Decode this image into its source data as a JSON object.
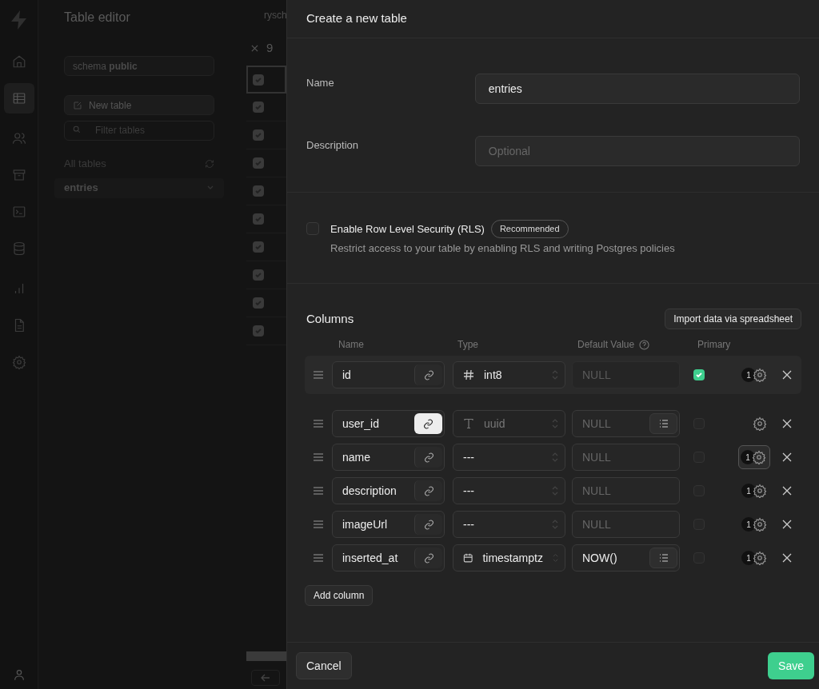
{
  "app": {
    "title": "Table editor",
    "schema": "schema **public**",
    "new_table": "New table",
    "filter": {
      "placeholder": "Filter tables"
    },
    "section": "All tables",
    "tables": [
      {
        "label": "entries",
        "selected": true
      }
    ],
    "grid": {
      "header_fragment": "rysch",
      "count": "9",
      "rows": [
        {
          "checked": true
        },
        {
          "checked": true
        },
        {
          "checked": true
        },
        {
          "checked": true
        },
        {
          "checked": true
        },
        {
          "checked": true
        },
        {
          "checked": true
        },
        {
          "checked": true
        },
        {
          "checked": true
        },
        {
          "checked": true
        }
      ]
    },
    "nav": [
      {
        "kind": "home",
        "selected": false
      },
      {
        "kind": "table",
        "selected": true
      },
      {
        "kind": "users",
        "selected": false
      },
      {
        "kind": "archive",
        "selected": false
      },
      {
        "kind": "terminal",
        "selected": false
      },
      {
        "kind": "database",
        "selected": false
      },
      {
        "kind": "chart",
        "selected": false
      },
      {
        "kind": "document",
        "selected": false
      },
      {
        "kind": "settings",
        "selected": false
      }
    ]
  },
  "panel": {
    "title": "Create a new table",
    "name": {
      "label": "Name",
      "value": "entries"
    },
    "description": {
      "label": "Description",
      "placeholder": "Optional"
    },
    "rls": {
      "checked": false,
      "label": "Enable Row Level Security (RLS)",
      "badge": "Recommended",
      "hint": "Restrict access to your table by enabling RLS and writing Postgres policies"
    },
    "columns": {
      "title": "Columns",
      "import_button": "Import data via spreadsheet",
      "headers": [
        "Name",
        "Type",
        "Default Value",
        "Primary"
      ],
      "rows": [
        {
          "name": "id",
          "link_active": false,
          "kind": "hash",
          "type": "int8",
          "type_disabled": false,
          "default_placeholder": "NULL",
          "default_disabled": true,
          "suggestions": false,
          "primary": true,
          "badge": "1",
          "highlighted": true,
          "focused": false
        },
        {
          "name": "user_id",
          "link_active": true,
          "kind": "text",
          "type": "uuid",
          "type_disabled": true,
          "default_placeholder": "NULL",
          "default_disabled": false,
          "suggestions": true,
          "primary": false,
          "highlighted": false,
          "focused": false
        },
        {
          "name": "name",
          "link_active": false,
          "kind": "none",
          "type": "---",
          "type_disabled": false,
          "default_placeholder": "NULL",
          "default_disabled": false,
          "suggestions": false,
          "primary": false,
          "badge": "1",
          "highlighted": false,
          "focused": true
        },
        {
          "name": "description",
          "link_active": false,
          "kind": "none",
          "type": "---",
          "type_disabled": false,
          "default_placeholder": "NULL",
          "default_disabled": false,
          "suggestions": false,
          "primary": false,
          "badge": "1",
          "highlighted": false,
          "focused": false
        },
        {
          "name": "imageUrl",
          "link_active": false,
          "kind": "none",
          "type": "---",
          "type_disabled": false,
          "default_placeholder": "NULL",
          "default_disabled": false,
          "suggestions": false,
          "primary": false,
          "badge": "1",
          "highlighted": false,
          "focused": false
        },
        {
          "name": "inserted_at",
          "link_active": false,
          "kind": "calendar",
          "type": "timestamptz",
          "type_disabled": false,
          "default_value": "NOW()",
          "default_disabled": false,
          "suggestions": true,
          "primary": false,
          "badge": "1",
          "highlighted": false,
          "focused": false
        }
      ],
      "add_button": "Add column"
    },
    "cancel": "Cancel",
    "save": "Save"
  }
}
